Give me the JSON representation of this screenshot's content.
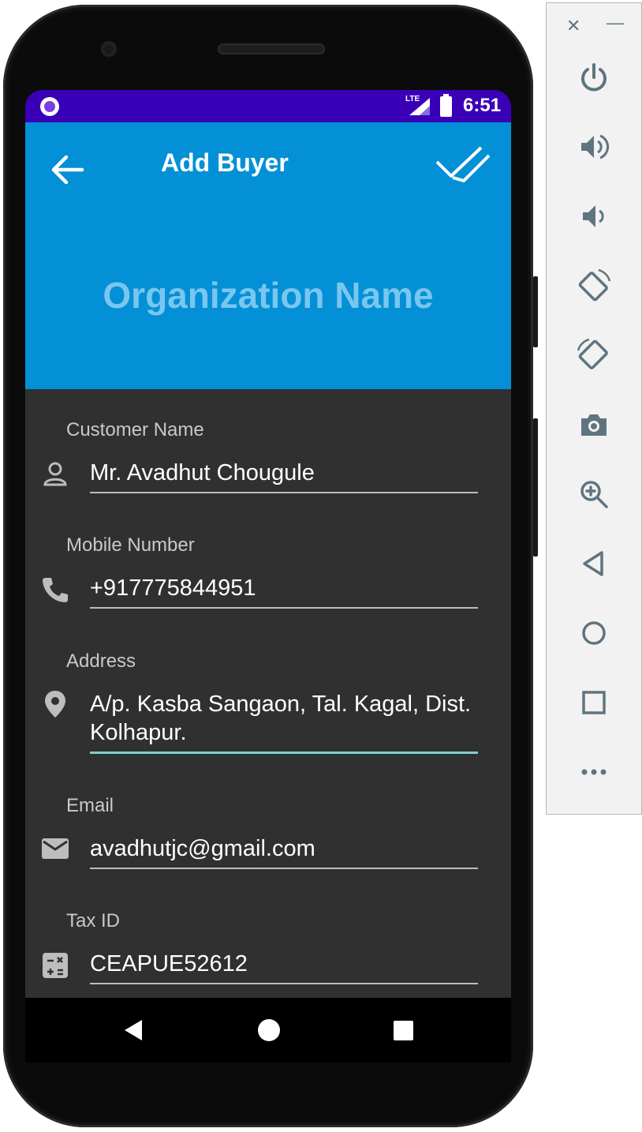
{
  "status_bar": {
    "time": "6:51",
    "network": "LTE"
  },
  "app_bar": {
    "title": "Add Buyer",
    "organization_name": "Organization Name"
  },
  "form": {
    "fields": [
      {
        "label": "Customer Name",
        "value": "Mr. Avadhut Chougule",
        "icon": "person-icon"
      },
      {
        "label": "Mobile Number",
        "value": "+917775844951",
        "icon": "phone-icon"
      },
      {
        "label": "Address",
        "value": "A/p. Kasba Sangaon, Tal. Kagal, Dist. Kolhapur.",
        "icon": "location-pin-icon",
        "focused": true
      },
      {
        "label": "Email",
        "value": "avadhutjc@gmail.com",
        "icon": "mail-icon"
      },
      {
        "label": "Tax ID",
        "value": "CEAPUE52612",
        "icon": "calculator-icon"
      }
    ]
  },
  "colors": {
    "status_bar": "#3a00b8",
    "app_bar": "#0390d6",
    "form_background": "#303030",
    "focus_underline": "#7ecfc8",
    "emulator_icon": "#5e7580"
  },
  "nav_bar": {
    "items": [
      "back-triangle-icon",
      "home-circle-icon",
      "recents-square-icon"
    ]
  },
  "emulator_panel": {
    "window_controls": [
      "close-icon",
      "minimize-icon"
    ],
    "buttons": [
      "power-icon",
      "volume-up-icon",
      "volume-down-icon",
      "rotate-left-icon",
      "rotate-right-icon",
      "camera-icon",
      "zoom-icon",
      "back-icon",
      "home-icon",
      "overview-icon",
      "more-icon"
    ]
  }
}
